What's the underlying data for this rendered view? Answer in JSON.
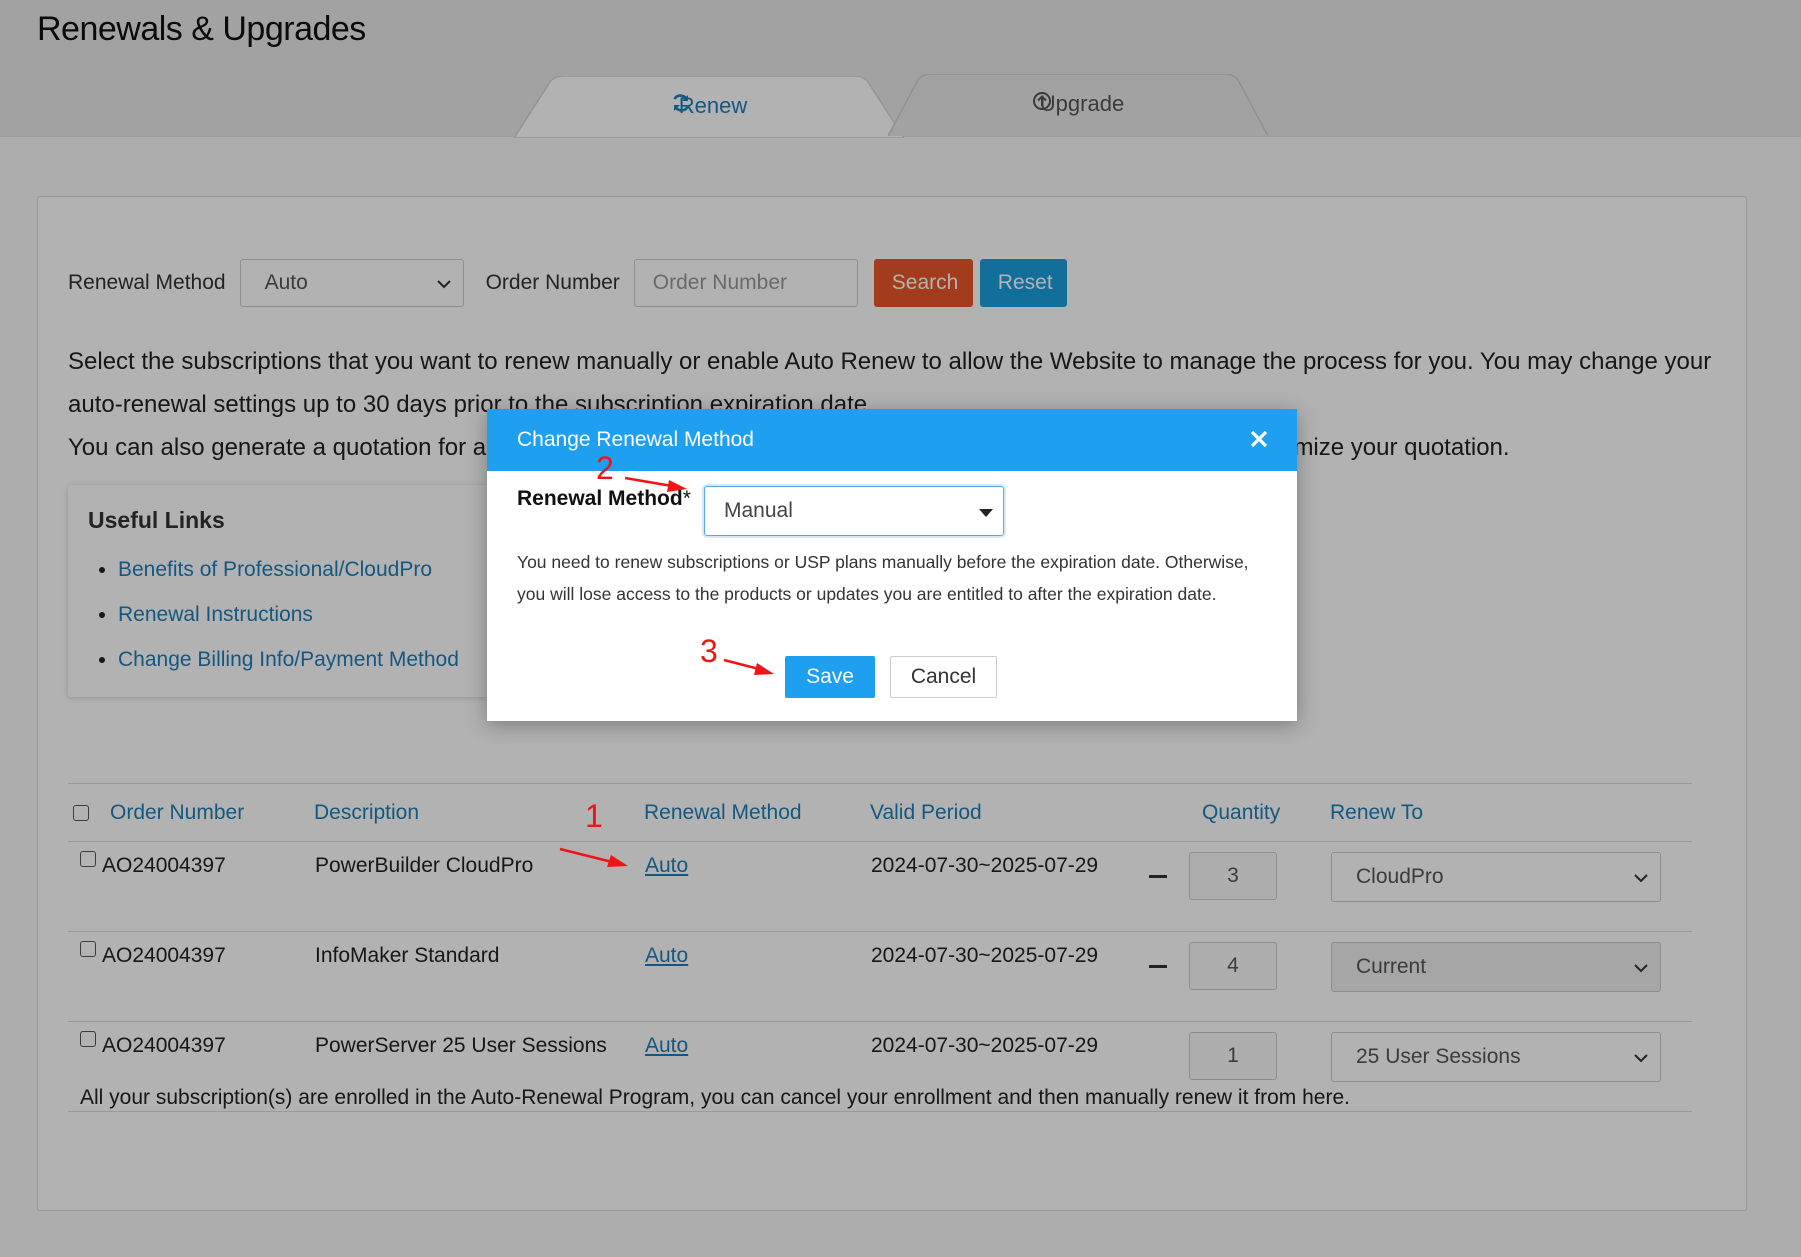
{
  "page": {
    "title": "Renewals & Upgrades"
  },
  "tabs": [
    {
      "label": "Renew",
      "icon": "refresh-icon",
      "active": true
    },
    {
      "label": "Upgrade",
      "icon": "arrow-up-circle-icon",
      "active": false
    }
  ],
  "filters": {
    "renewal_method_label": "Renewal Method",
    "renewal_method_value": "Auto",
    "order_number_label": "Order Number",
    "order_number_placeholder": "Order Number",
    "order_number_value": "",
    "search_label": "Search",
    "reset_label": "Reset"
  },
  "intro": {
    "line1": "Select the subscriptions that you want to renew manually or enable Auto Renew to allow the Website to manage the process for you. You may change your",
    "line2": "auto-renewal settings up to 30 days prior to the subscription expiration date.",
    "line3_start": "You can also generate a quotation for al",
    "line3_end": "mize your quotation."
  },
  "useful_links": {
    "title": "Useful Links",
    "items": [
      "Benefits of Professional/CloudPro",
      "Renewal Instructions",
      "Change Billing Info/Payment Method"
    ]
  },
  "table": {
    "columns": [
      "Order Number",
      "Description",
      "Renewal Method",
      "Valid Period",
      "Quantity",
      "Renew To"
    ],
    "rows": [
      {
        "order": "AO24004397",
        "description": "PowerBuilder CloudPro",
        "method": "Auto",
        "period": "2024-07-30~2025-07-29",
        "quantity": "3",
        "renew_to": "CloudPro",
        "has_minus": true,
        "renew_disabled": false
      },
      {
        "order": "AO24004397",
        "description": "InfoMaker Standard",
        "method": "Auto",
        "period": "2024-07-30~2025-07-29",
        "quantity": "4",
        "renew_to": "Current",
        "has_minus": true,
        "renew_disabled": true
      },
      {
        "order": "AO24004397",
        "description": "PowerServer 25 User Sessions",
        "method": "Auto",
        "period": "2024-07-30~2025-07-29",
        "quantity": "1",
        "renew_to": "25 User Sessions",
        "has_minus": false,
        "renew_disabled": false
      }
    ]
  },
  "footnote": "All your subscription(s) are enrolled in the Auto-Renewal Program, you can cancel your enrollment and then manually renew it from here.",
  "modal": {
    "title": "Change Renewal Method",
    "field_label": "Renewal Method",
    "required_mark": "*",
    "selected_value": "Manual",
    "help_line1": "You need to renew subscriptions or USP plans manually before the expiration date. Otherwise,",
    "help_line2": "you will lose access to the products or updates you are entitled to after the expiration date.",
    "save_label": "Save",
    "cancel_label": "Cancel"
  },
  "annotations": [
    "1",
    "2",
    "3"
  ],
  "colors": {
    "link_blue": "#1e7fb8",
    "search_orange": "#e8562a",
    "reset_blue": "#1ba0db",
    "modal_header": "#1f9ff0",
    "annotation_red": "#f01414"
  }
}
